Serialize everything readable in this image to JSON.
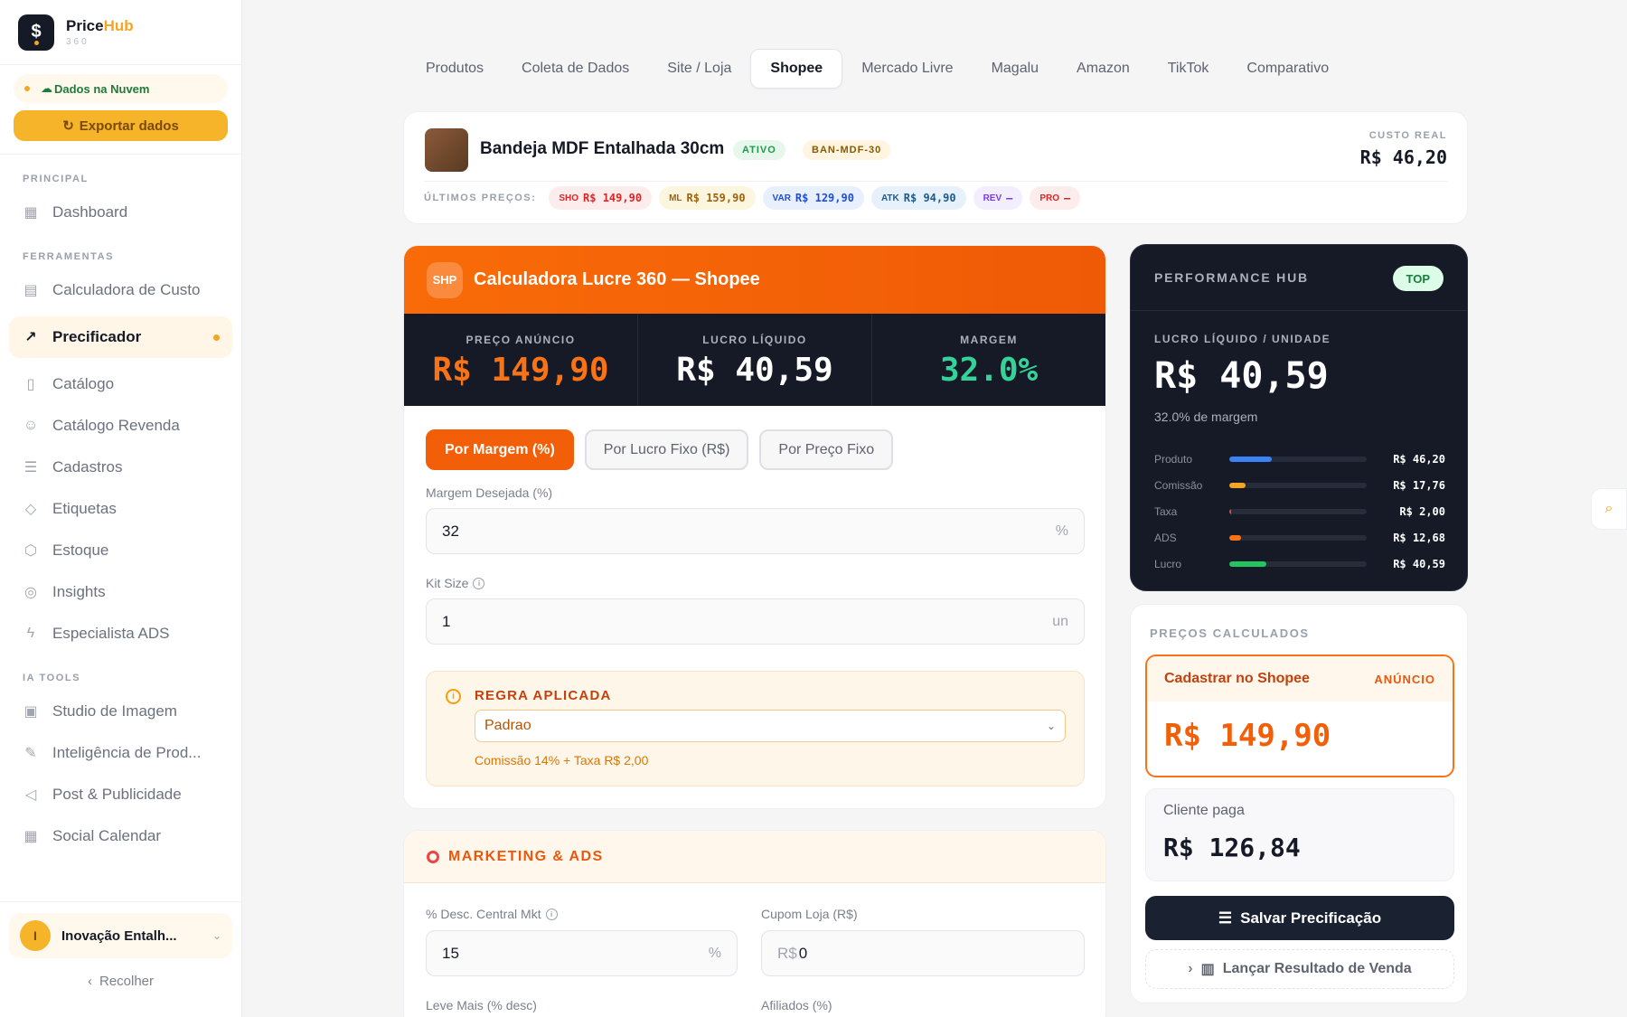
{
  "brand": {
    "name_a": "Price",
    "name_b": "Hub",
    "sub": "360"
  },
  "sidebar": {
    "cloud_status": "Dados na Nuvem",
    "export_label": "Exportar dados",
    "sections": {
      "principal": "PRINCIPAL",
      "ferramentas": "FERRAMENTAS",
      "ia_tools": "IA TOOLS"
    },
    "items": [
      {
        "label": "Dashboard",
        "icon": "grid-icon"
      },
      {
        "label": "Calculadora de Custo",
        "icon": "calculator-icon"
      },
      {
        "label": "Precificador",
        "icon": "trending-up-icon"
      },
      {
        "label": "Catálogo",
        "icon": "book-icon"
      },
      {
        "label": "Catálogo Revenda",
        "icon": "users-icon"
      },
      {
        "label": "Cadastros",
        "icon": "list-icon"
      },
      {
        "label": "Etiquetas",
        "icon": "tag-icon"
      },
      {
        "label": "Estoque",
        "icon": "box-icon"
      },
      {
        "label": "Insights",
        "icon": "globe-icon"
      },
      {
        "label": "Especialista ADS",
        "icon": "bolt-icon"
      },
      {
        "label": "Studio de Imagem",
        "icon": "image-icon"
      },
      {
        "label": "Inteligência de Prod...",
        "icon": "pen-icon"
      },
      {
        "label": "Post & Publicidade",
        "icon": "megaphone-icon"
      },
      {
        "label": "Social Calendar",
        "icon": "calendar-icon"
      }
    ],
    "user": {
      "initial": "I",
      "name": "Inovação Entalh..."
    },
    "collapse_label": "Recolher"
  },
  "tabs": [
    {
      "label": "Produtos"
    },
    {
      "label": "Coleta de Dados"
    },
    {
      "label": "Site / Loja"
    },
    {
      "label": "Shopee"
    },
    {
      "label": "Mercado Livre"
    },
    {
      "label": "Magalu"
    },
    {
      "label": "Amazon"
    },
    {
      "label": "TikTok"
    },
    {
      "label": "Comparativo"
    }
  ],
  "product": {
    "name": "Bandeja MDF Entalhada 30cm",
    "status": "ATIVO",
    "sku": "BAN-MDF-30",
    "cost_label": "CUSTO REAL",
    "cost_value": "R$ 46,20",
    "last_prices_label": "ÚLTIMOS PREÇOS:",
    "last_prices": [
      {
        "code": "SHO",
        "value": "R$ 149,90",
        "bg": "#fdecec",
        "color": "#dc2626"
      },
      {
        "code": "ML",
        "value": "R$ 159,90",
        "bg": "#fdf6df",
        "color": "#a16207"
      },
      {
        "code": "VAR",
        "value": "R$ 129,90",
        "bg": "#e9f0fd",
        "color": "#1d4ed8"
      },
      {
        "code": "ATK",
        "value": "R$ 94,90",
        "bg": "#e7f1fb",
        "color": "#1e5a8a"
      },
      {
        "code": "REV",
        "value": "—",
        "bg": "#f3eefd",
        "color": "#7c3aed"
      },
      {
        "code": "PRO",
        "value": "—",
        "bg": "#fdecec",
        "color": "#dc2626"
      }
    ]
  },
  "calc": {
    "badge": "SHP",
    "title": "Calculadora Lucre 360 — Shopee",
    "metrics": [
      {
        "label": "PREÇO ANÚNCIO",
        "value": "R$ 149,90",
        "color": "#f97316"
      },
      {
        "label": "LUCRO LÍQUIDO",
        "value": "R$ 40,59",
        "color": "#ffffff"
      },
      {
        "label": "MARGEM",
        "value": "32.0%",
        "color": "#34d399"
      }
    ],
    "modes": [
      {
        "label": "Por Margem (%)"
      },
      {
        "label": "Por Lucro Fixo (R$)"
      },
      {
        "label": "Por Preço Fixo"
      }
    ],
    "margin_label": "Margem Desejada (%)",
    "margin_value": "32",
    "margin_suffix": "%",
    "kit_label": "Kit Size",
    "kit_value": "1",
    "kit_suffix": "un",
    "rule_title": "REGRA APLICADA",
    "rule_selected": "Padrao",
    "rule_note": "Comissão 14% + Taxa R$ 2,00"
  },
  "marketing": {
    "title": "MARKETING & ADS",
    "desc_label": "% Desc. Central Mkt",
    "desc_value": "15",
    "desc_suffix": "%",
    "cupom_label": "Cupom Loja (R$)",
    "cupom_prefix": "R$",
    "cupom_value": "0",
    "leve_label": "Leve Mais (% desc)",
    "afiliados_label": "Afiliados (%)"
  },
  "performance": {
    "title": "PERFORMANCE HUB",
    "badge": "TOP",
    "label": "LUCRO LÍQUIDO / UNIDADE",
    "value": "R$ 40,59",
    "sub": "32.0% de margem",
    "bars": [
      {
        "name": "Produto",
        "value": "R$ 46,20",
        "fraction": 0.31,
        "color": "#3b82f6"
      },
      {
        "name": "Comissão",
        "value": "R$ 17,76",
        "fraction": 0.12,
        "color": "#f5a524"
      },
      {
        "name": "Taxa",
        "value": "R$ 2,00",
        "fraction": 0.013,
        "color": "#ef4444"
      },
      {
        "name": "ADS",
        "value": "R$ 12,68",
        "fraction": 0.085,
        "color": "#f97316"
      },
      {
        "name": "Lucro",
        "value": "R$ 40,59",
        "fraction": 0.27,
        "color": "#22c55e"
      }
    ]
  },
  "prices_calc": {
    "title": "PREÇOS CALCULADOS",
    "main_name": "Cadastrar no Shopee",
    "main_tag": "ANÚNCIO",
    "main_value": "R$ 149,90",
    "client_label": "Cliente paga",
    "client_value": "R$ 126,84",
    "save_label": "Salvar Precificação",
    "launch_label": "Lançar Resultado de Venda"
  }
}
